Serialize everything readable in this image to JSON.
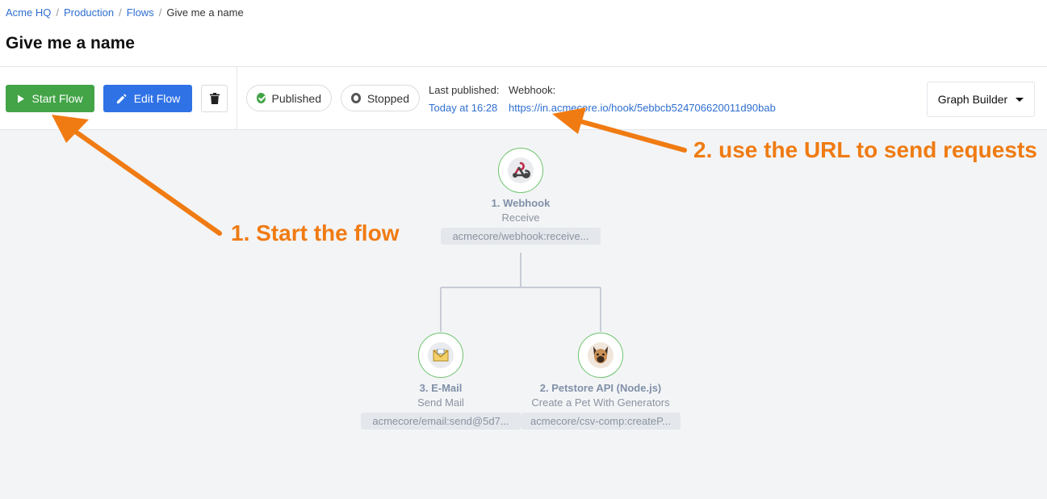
{
  "breadcrumb": [
    "Acme HQ",
    "Production",
    "Flows",
    "Give me a name"
  ],
  "page_title": "Give me a name",
  "toolbar": {
    "start_label": "Start Flow",
    "edit_label": "Edit Flow",
    "published_label": "Published",
    "stopped_label": "Stopped",
    "last_published_label": "Last published:",
    "last_published_value": "Today at 16:28",
    "webhook_label": "Webhook:",
    "webhook_url": "https://in.acmecore.io/hook/5ebbcb524706620011d90bab",
    "view_label": "Graph Builder"
  },
  "nodes": [
    {
      "title": "1. Webhook",
      "subtitle": "Receive",
      "tag": "acmecore/webhook:receive...",
      "icon": "webhook-icon"
    },
    {
      "title": "3. E-Mail",
      "subtitle": "Send Mail",
      "tag": "acmecore/email:send@5d7...",
      "icon": "email-icon"
    },
    {
      "title": "2. Petstore API (Node.js)",
      "subtitle": "Create a Pet With Generators",
      "tag": "acmecore/csv-comp:createP...",
      "icon": "dog-icon"
    }
  ],
  "annotations": {
    "start": "1. Start the flow",
    "url": "2. use the URL to send requests"
  },
  "colors": {
    "start_button": "#43a447",
    "edit_button": "#2f72e6",
    "link": "#2f6fd0",
    "node_border": "#6cc46c",
    "annotation": "#f07b12"
  }
}
